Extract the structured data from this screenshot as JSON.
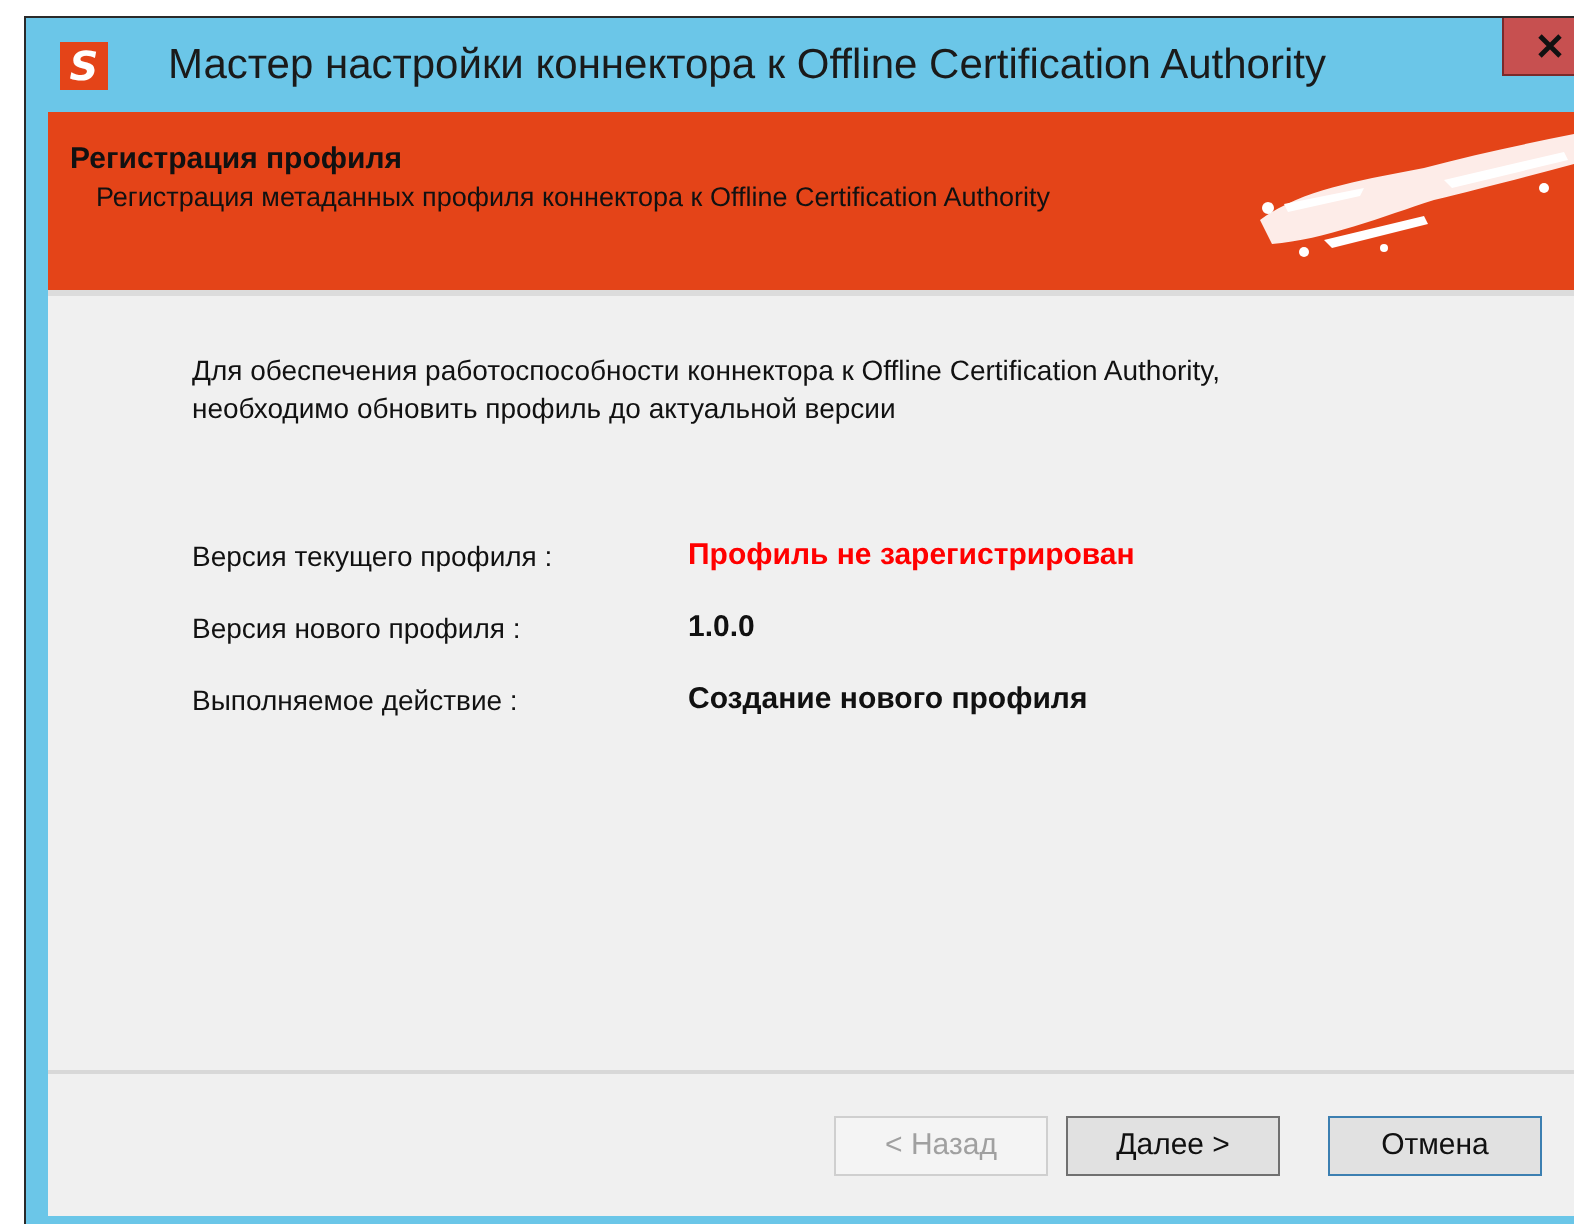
{
  "window": {
    "title": "Мастер настройки коннектора к Offline Certification Authority",
    "logo_letter": "S"
  },
  "header": {
    "title": "Регистрация профиля",
    "subtitle": "Регистрация метаданных профиля коннектора к Offline Certification Authority"
  },
  "intro": "Для обеспечения работоспособности коннектора к Offline Certification Authority, необходимо обновить профиль до актуальной версии",
  "fields": [
    {
      "label": "Версия текущего профиля :",
      "value": "Профиль не зарегистрирован",
      "kind": "error"
    },
    {
      "label": "Версия нового профиля :",
      "value": "1.0.0",
      "kind": "normal"
    },
    {
      "label": "Выполняемое действие :",
      "value": "Создание нового профиля",
      "kind": "normal"
    }
  ],
  "buttons": [
    {
      "label": "< Назад",
      "disabled": true,
      "kind": "plain"
    },
    {
      "label": "Далее >",
      "disabled": false,
      "kind": "default"
    },
    {
      "label": "Отмена",
      "disabled": false,
      "kind": "focused"
    }
  ]
}
